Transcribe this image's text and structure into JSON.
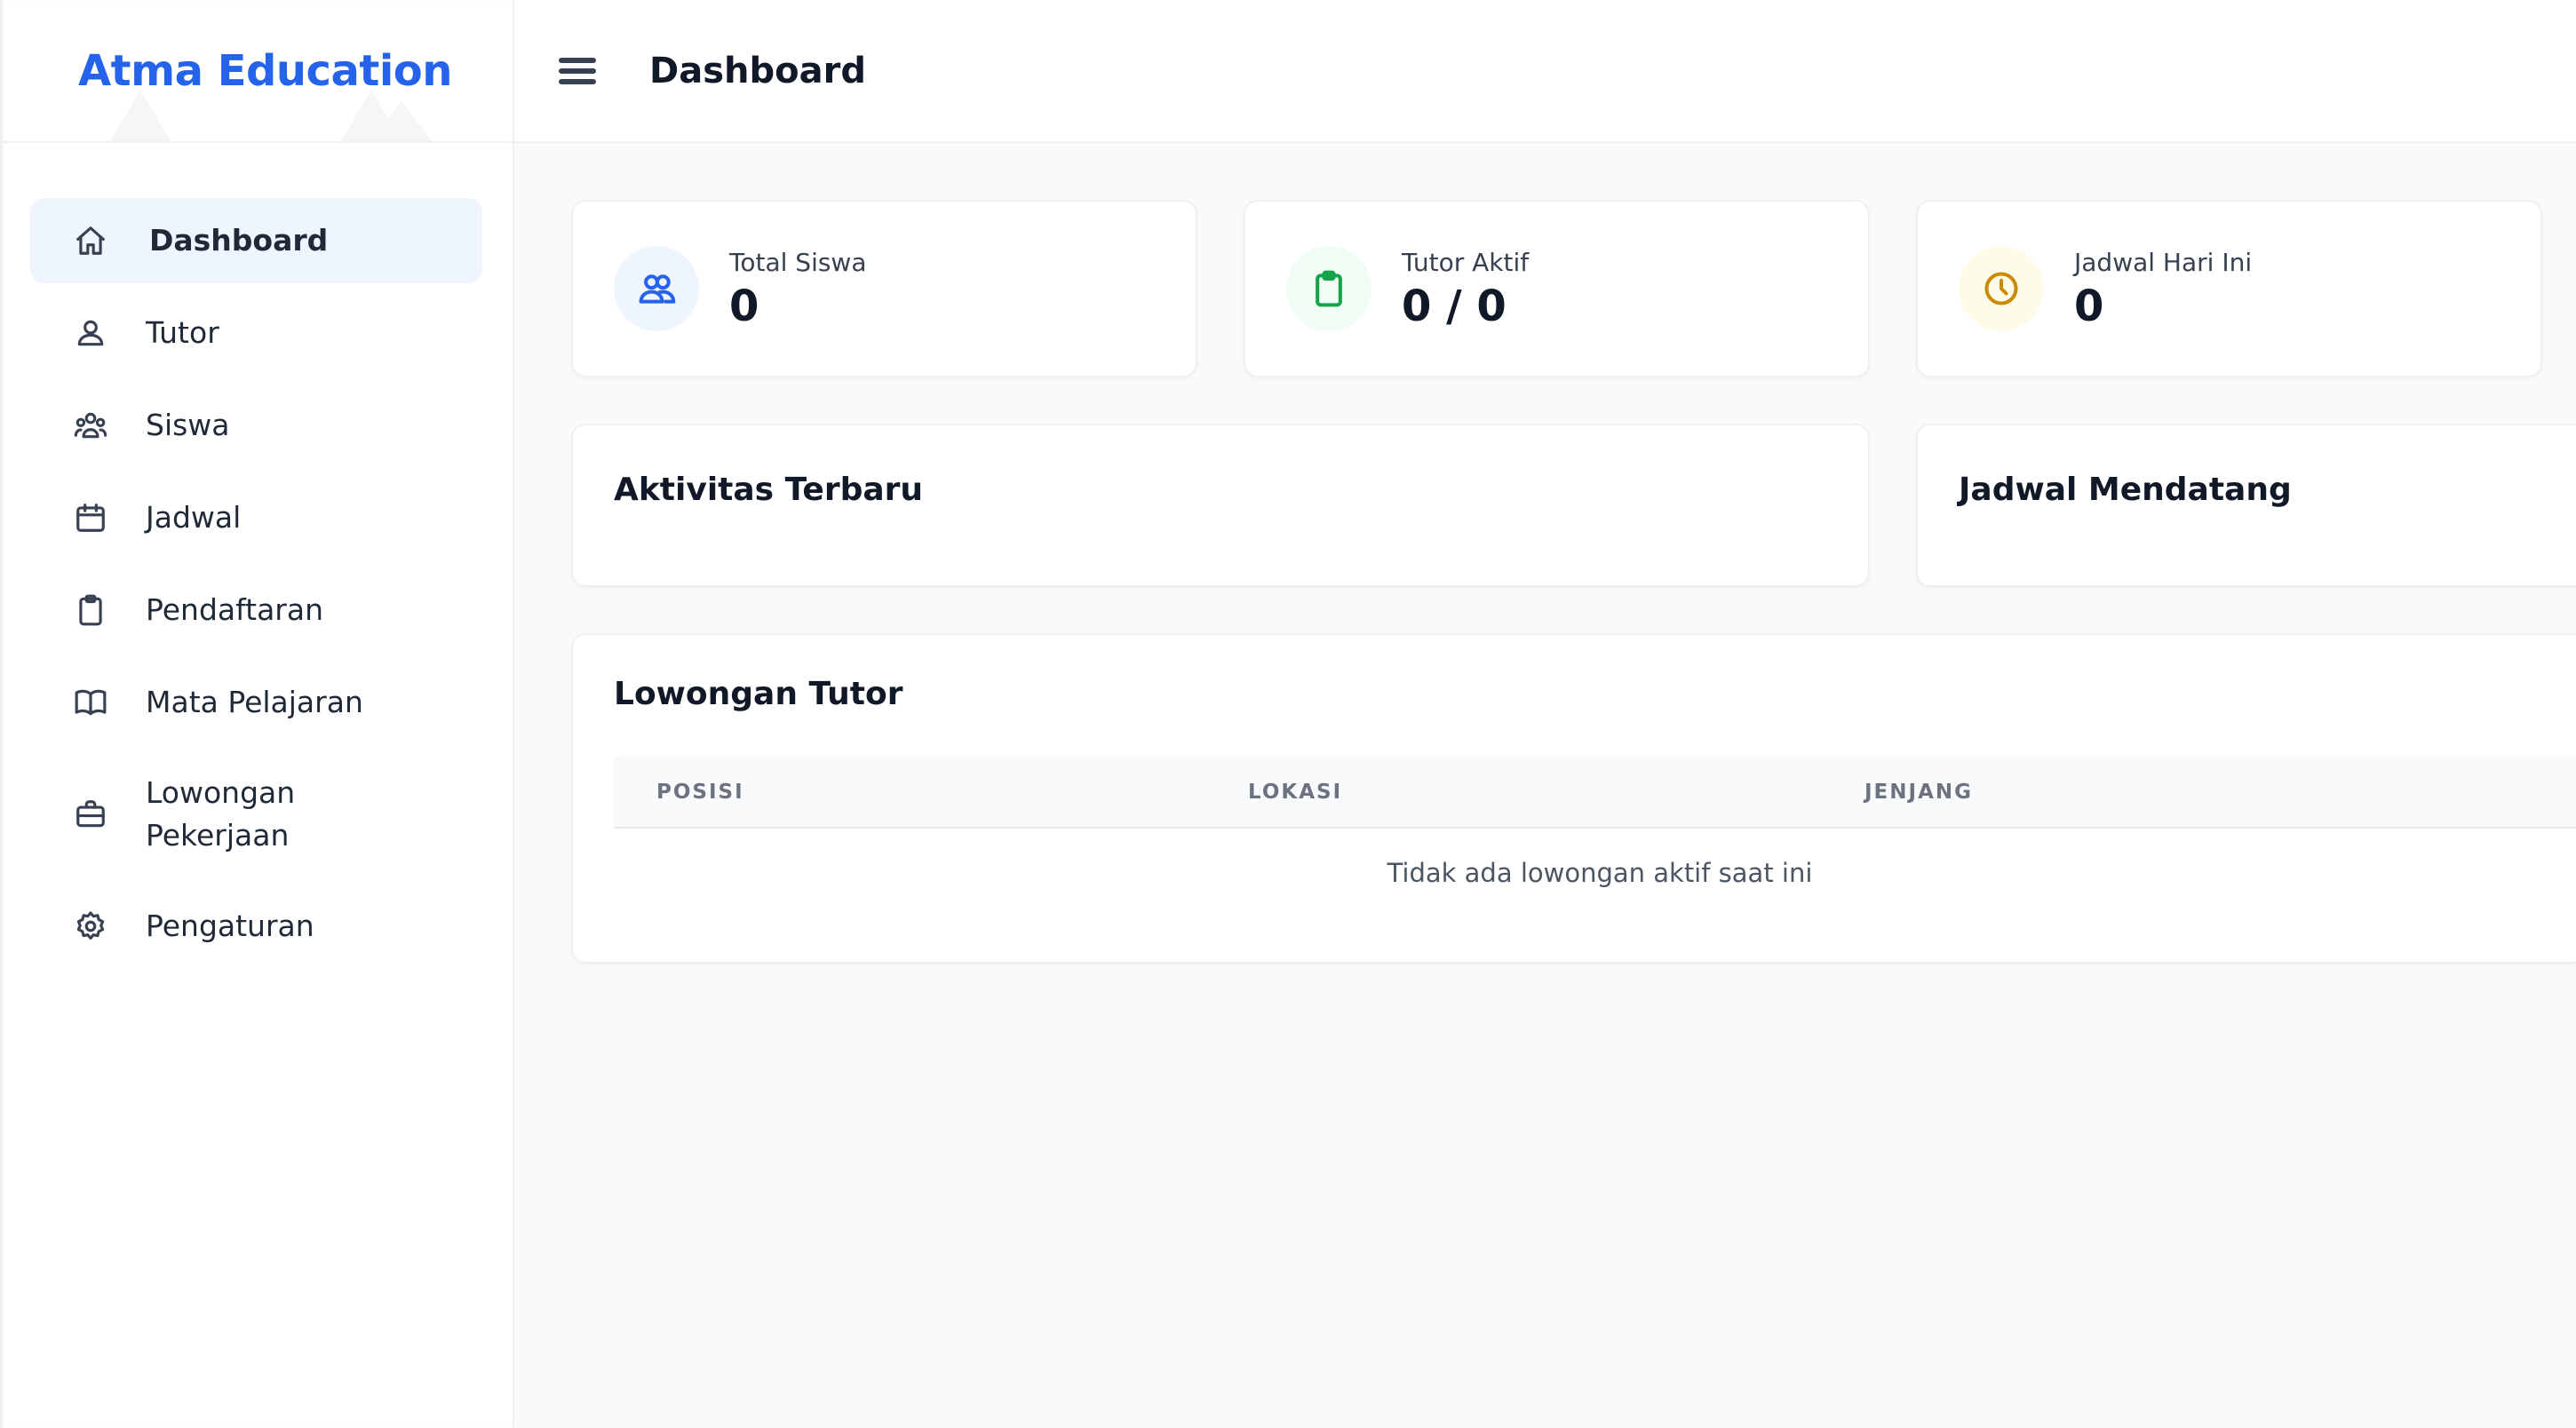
{
  "brand": {
    "name": "Atma Education",
    "color": "#2563eb"
  },
  "sidebar": {
    "items": [
      {
        "label": "Dashboard",
        "icon": "home-icon",
        "active": true
      },
      {
        "label": "Tutor",
        "icon": "user-icon"
      },
      {
        "label": "Siswa",
        "icon": "users-icon"
      },
      {
        "label": "Jadwal",
        "icon": "calendar-icon"
      },
      {
        "label": "Pendaftaran",
        "icon": "clipboard-icon"
      },
      {
        "label": "Mata Pelajaran",
        "icon": "book-icon"
      },
      {
        "label": "Lowongan Pekerjaan",
        "icon": "briefcase-icon"
      },
      {
        "label": "Pengaturan",
        "icon": "gear-icon"
      }
    ]
  },
  "header": {
    "title": "Dashboard",
    "menu_icon": "hamburger-icon"
  },
  "stats": [
    {
      "label": "Total Siswa",
      "value": "0",
      "icon": "users-icon",
      "icon_color": "#2563eb",
      "icon_bg": "#eff5ff"
    },
    {
      "label": "Tutor Aktif",
      "value": "0 / 0",
      "icon": "clipboard-icon",
      "icon_color": "#16a34a",
      "icon_bg": "#f0fdf4"
    },
    {
      "label": "Jadwal Hari Ini",
      "value": "0",
      "icon": "clock-icon",
      "icon_color": "#ca8a04",
      "icon_bg": "#fefce8"
    }
  ],
  "panels": {
    "recent_activity": {
      "title": "Aktivitas Terbaru"
    },
    "upcoming_schedule": {
      "title": "Jadwal Mendatang"
    }
  },
  "vacancies": {
    "title": "Lowongan Tutor",
    "columns": [
      "POSISI",
      "LOKASI",
      "JENJANG"
    ],
    "empty_message": "Tidak ada lowongan aktif saat ini"
  }
}
